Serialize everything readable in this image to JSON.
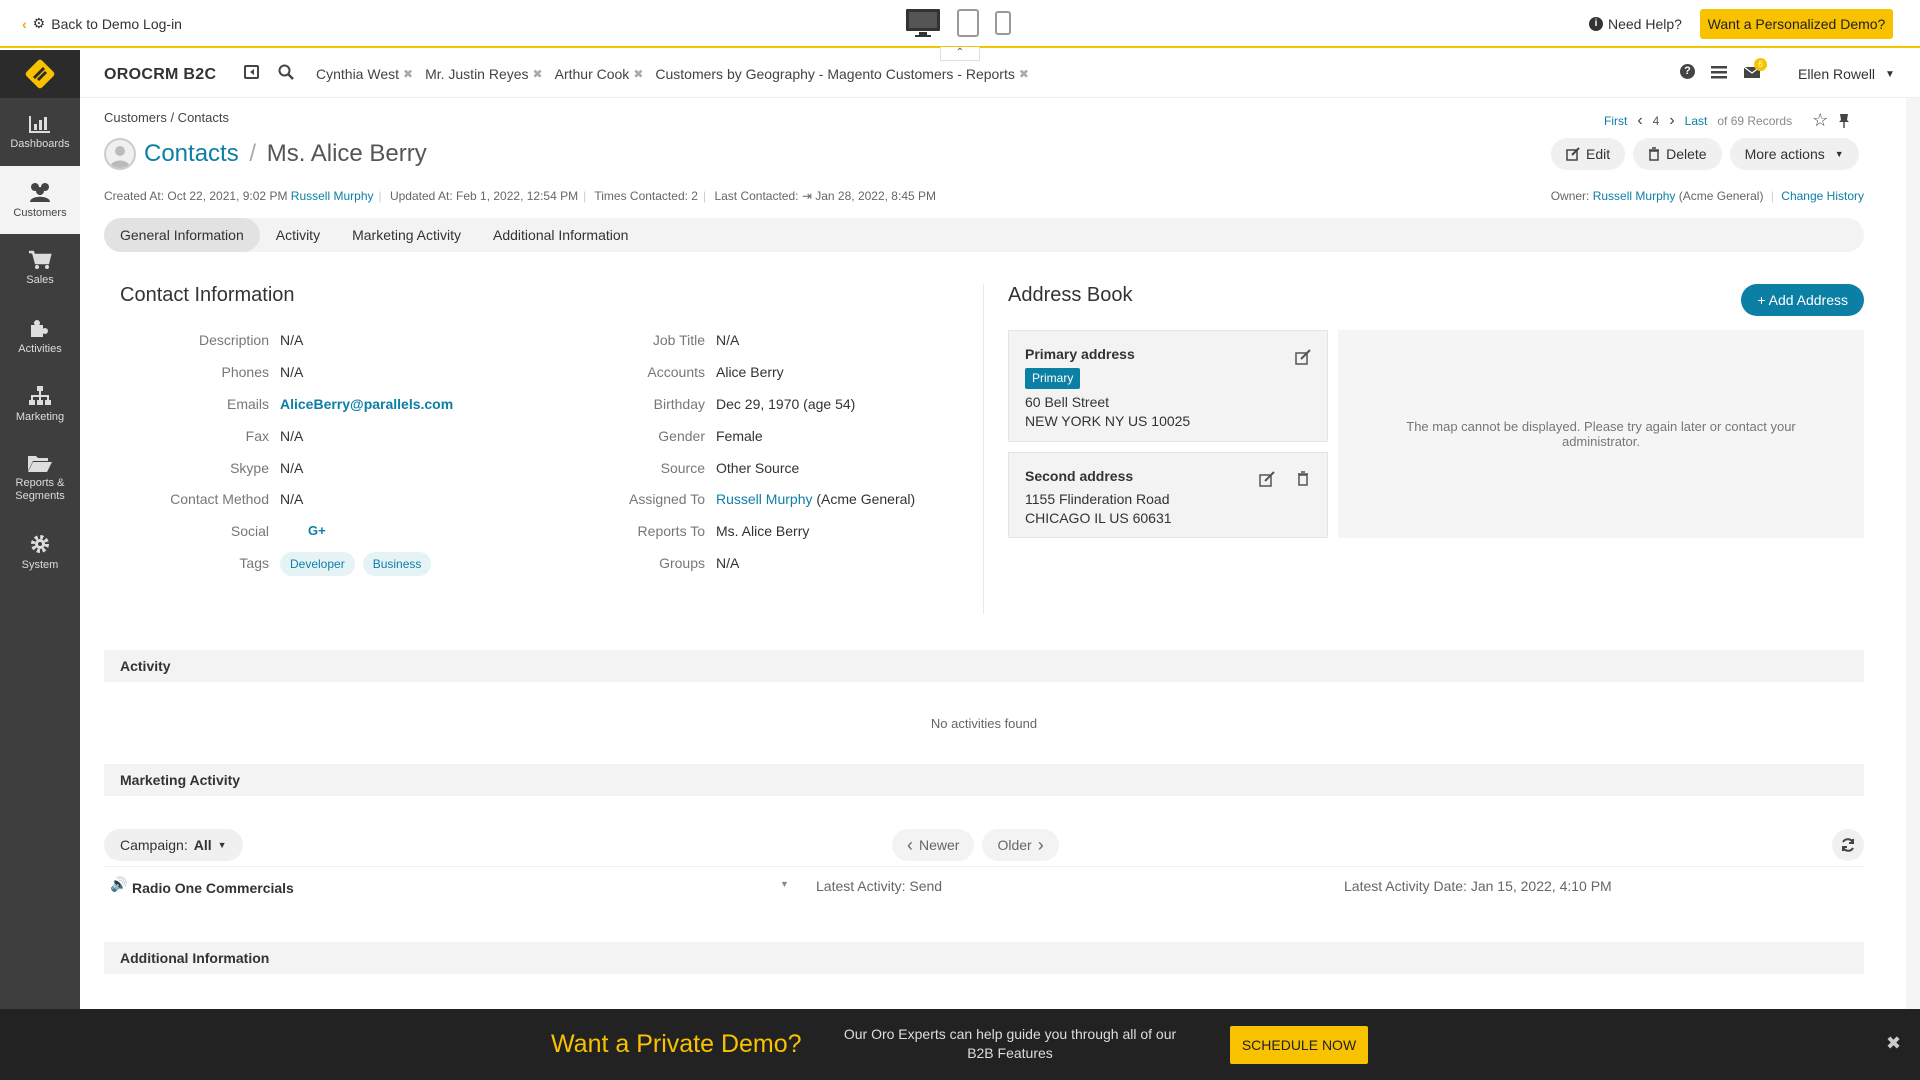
{
  "demo_bar": {
    "back_label": "Back to Demo Log-in",
    "need_help": "Need Help?",
    "personal_demo": "Want a Personalized Demo?"
  },
  "sidebar": {
    "items": [
      {
        "label": "Dashboards",
        "icon": "bar-chart-icon"
      },
      {
        "label": "Customers",
        "icon": "users-icon"
      },
      {
        "label": "Sales",
        "icon": "cart-icon"
      },
      {
        "label": "Activities",
        "icon": "puzzle-icon"
      },
      {
        "label": "Marketing",
        "icon": "sitemap-icon"
      },
      {
        "label": "Reports & Segments",
        "icon": "folder-open-icon"
      },
      {
        "label": "System",
        "icon": "gear-icon"
      }
    ]
  },
  "header": {
    "brand": "OROCRM B2C",
    "pins": [
      "Cynthia West",
      "Mr. Justin Reyes",
      "Arthur Cook",
      "Customers by Geography - Magento Customers - Reports"
    ],
    "notification_count": "6",
    "user": "Ellen Rowell"
  },
  "page": {
    "breadcrumb": "Customers / Contacts",
    "pager": {
      "first": "First",
      "current": "4",
      "last": "Last",
      "total": "of 69 Records"
    },
    "title_crumb": "Contacts",
    "title_sep": "/",
    "title": "Ms. Alice Berry",
    "actions": {
      "edit": "Edit",
      "delete": "Delete",
      "more": "More actions"
    },
    "meta": {
      "created": "Created At: Oct 22, 2021, 9:02 PM",
      "created_by": "Russell Murphy",
      "updated": "Updated At: Feb 1, 2022, 12:54 PM",
      "times_contacted": "Times Contacted: 2",
      "last_contacted_label": "Last Contacted:",
      "last_contacted": "Jan 28, 2022, 8:45 PM"
    },
    "owner": {
      "label": "Owner:",
      "name": "Russell Murphy",
      "org": "(Acme General)",
      "history": "Change History"
    },
    "tabs": [
      "General Information",
      "Activity",
      "Marketing Activity",
      "Additional Information"
    ]
  },
  "contact_info": {
    "title": "Contact Information",
    "left": [
      {
        "label": "Description",
        "value": "N/A"
      },
      {
        "label": "Phones",
        "value": "N/A"
      },
      {
        "label": "Emails",
        "value": "AliceBerry@parallels.com"
      },
      {
        "label": "Fax",
        "value": "N/A"
      },
      {
        "label": "Skype",
        "value": "N/A"
      },
      {
        "label": "Contact Method",
        "value": "N/A"
      },
      {
        "label": "Social",
        "value": "G+"
      }
    ],
    "tags_label": "Tags",
    "tags": [
      "Developer",
      "Business"
    ],
    "right": [
      {
        "label": "Job Title",
        "value": "N/A"
      },
      {
        "label": "Accounts",
        "value": "Alice Berry"
      },
      {
        "label": "Birthday",
        "value": "Dec 29, 1970 (age 54)"
      },
      {
        "label": "Gender",
        "value": "Female"
      },
      {
        "label": "Source",
        "value": "Other Source"
      },
      {
        "label": "Assigned To",
        "value": "Russell Murphy",
        "extra": "(Acme General)"
      },
      {
        "label": "Reports To",
        "value": "Ms. Alice Berry"
      },
      {
        "label": "Groups",
        "value": "N/A"
      }
    ]
  },
  "address_book": {
    "title": "Address Book",
    "add_button": "+ Add Address",
    "primary": {
      "title": "Primary address",
      "badge": "Primary",
      "line1": "60 Bell Street",
      "line2": "NEW YORK NY US 10025"
    },
    "second": {
      "title": "Second address",
      "line1": "1155 Flinderation Road",
      "line2": "CHICAGO IL US 60631"
    },
    "map_message": "The map cannot be displayed. Please try again later or contact your administrator."
  },
  "activity": {
    "title": "Activity",
    "empty": "No activities found"
  },
  "marketing": {
    "title": "Marketing Activity",
    "campaign_label": "Campaign:",
    "campaign_value": "All",
    "newer": "Newer",
    "older": "Older",
    "row": {
      "name": "Radio One Commercials",
      "latest": "Latest Activity: Send",
      "date": "Latest Activity Date: Jan 15, 2022, 4:10 PM"
    }
  },
  "additional": {
    "title": "Additional Information"
  },
  "footer": {
    "title": "Want a Private Demo?",
    "text": "Our Oro Experts can help guide you through all of our B2B Features",
    "button": "SCHEDULE NOW"
  },
  "colors": {
    "accent": "#0c7fa5",
    "brand_yellow": "#f8c200",
    "sidebar": "#3e3e3e"
  }
}
